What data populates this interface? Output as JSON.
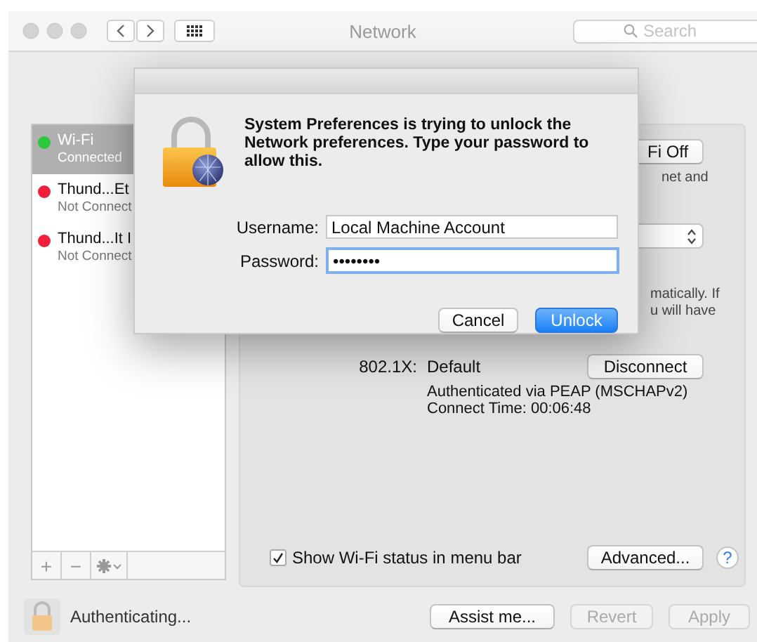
{
  "window": {
    "title": "Network",
    "search_placeholder": "Search"
  },
  "sidebar": {
    "items": [
      {
        "name": "Wi-Fi",
        "status": "Connected",
        "color": "#2ac83c",
        "selected": true
      },
      {
        "name": "Thund...Et",
        "status": "Not Connect",
        "color": "#f0203a",
        "selected": false
      },
      {
        "name": "Thund...It I",
        "status": "Not Connect",
        "color": "#f0203a",
        "selected": false
      }
    ],
    "tools": [
      "+",
      "−"
    ]
  },
  "detail": {
    "wifi_button": "Fi Off",
    "wifi_note": "net and",
    "auto_join_note": [
      "matically. If",
      "u will have"
    ],
    "eap": {
      "label": "802.1X:",
      "value": "Default",
      "button": "Disconnect",
      "lines": [
        "Authenticated via PEAP (MSCHAPv2)",
        "Connect Time: 00:06:48"
      ]
    },
    "show_status": {
      "label": "Show Wi-Fi status in menu bar",
      "checked": true
    },
    "advanced": "Advanced...",
    "help": "?"
  },
  "footer": {
    "status": "Authenticating...",
    "buttons": [
      {
        "label": "Assist me...",
        "disabled": false
      },
      {
        "label": "Revert",
        "disabled": true
      },
      {
        "label": "Apply",
        "disabled": true
      }
    ]
  },
  "dialog": {
    "message": "System Preferences is trying to unlock the Network preferences. Type your password to allow this.",
    "username": {
      "label": "Username:",
      "value": "Local Machine Account",
      "focused": false
    },
    "password": {
      "label": "Password:",
      "value": "••••••••",
      "focused": true
    },
    "buttons": [
      {
        "label": "Cancel",
        "default": false
      },
      {
        "label": "Unlock",
        "default": true
      }
    ]
  }
}
